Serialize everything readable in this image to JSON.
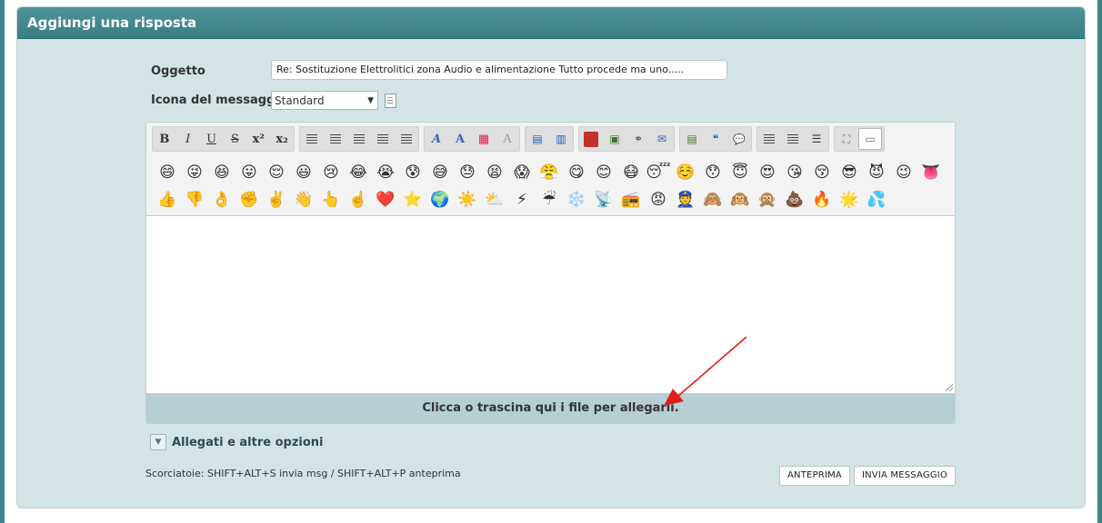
{
  "panel": {
    "title": "Aggiungi una risposta"
  },
  "form": {
    "subject_label": "Oggetto",
    "subject_value": "Re: Sostituzione Elettrolitici zona Audio e alimentazione Tutto procede ma uno.....",
    "icon_label": "Icona del messaggio",
    "icon_selected": "Standard"
  },
  "toolbar": {
    "icons": [
      "bold-icon",
      "italic-icon",
      "underline-icon",
      "strikethrough-icon",
      "superscript-icon",
      "subscript-icon",
      "align-left-icon",
      "align-center-icon",
      "align-right-icon",
      "justify-icon",
      "font-icon",
      "font-size-icon",
      "color-icon",
      "remove-format-icon",
      "table-icon",
      "table-row-icon",
      "youtube-icon",
      "image-icon",
      "link-icon",
      "email-icon",
      "insert-icon",
      "quote-icon",
      "comment-icon",
      "bullet-list-icon",
      "numbered-list-icon",
      "horizontal-rule-icon",
      "maximize-icon",
      "source-icon"
    ]
  },
  "emoji_rows": [
    [
      "😄",
      "😜",
      "😆",
      "😛",
      "😌",
      "😃",
      "😢",
      "😂",
      "😭",
      "😰",
      "😅",
      "😓",
      "😫",
      "😱",
      "😤",
      "😋",
      "😊",
      "😷",
      "😴",
      "☺️",
      "😯",
      "😇",
      "😍",
      "😘",
      "😚",
      "😎",
      "😈",
      "😉",
      "👅"
    ],
    [
      "👍",
      "👎",
      "👌",
      "✊",
      "✌️",
      "👋",
      "👆",
      "☝️",
      "❤️",
      "⭐",
      "🌍",
      "☀️",
      "⛅",
      "⚡",
      "☔",
      "❄️",
      "📡",
      "📻",
      "😡",
      "👮",
      "🙈",
      "🙉",
      "🙊",
      "💩",
      "🔥",
      "🌟",
      "💦"
    ]
  ],
  "dropzone": {
    "text": "Clicca o trascina qui i file per allegarli."
  },
  "options": {
    "label": "Allegati e altre opzioni"
  },
  "shortcuts": {
    "text": "Scorciatoie: SHIFT+ALT+S invia msg / SHIFT+ALT+P anteprima"
  },
  "buttons": {
    "preview": "ANTEPRIMA",
    "submit": "INVIA MESSAGGIO"
  },
  "colors": {
    "header": "#3b7f86",
    "panel_bg": "#d4e4e6",
    "dropzone": "#b5cfd2",
    "annotation_arrow": "#e01b1b"
  }
}
